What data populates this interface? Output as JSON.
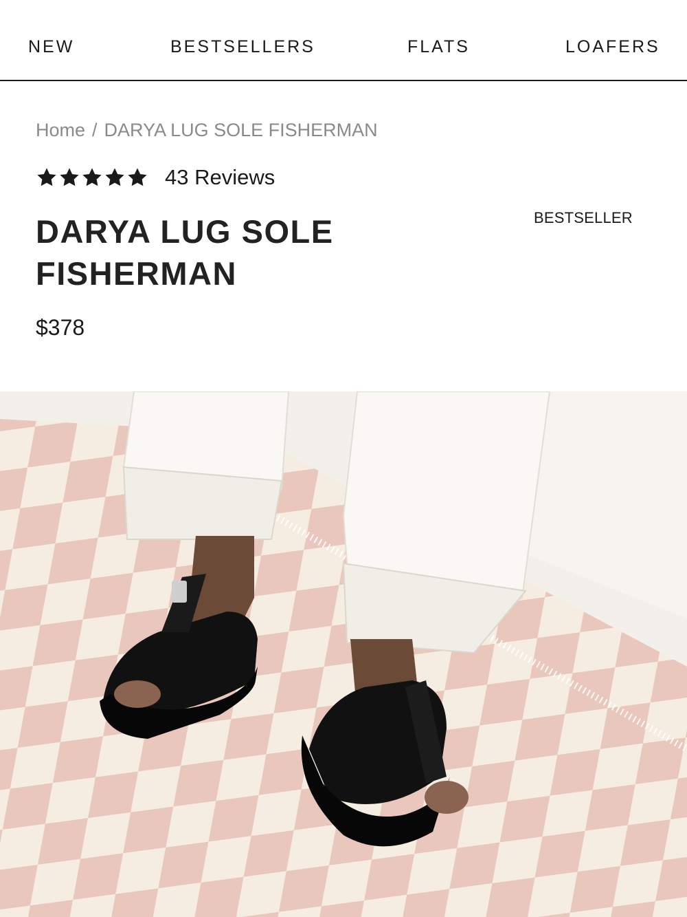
{
  "nav": {
    "items": [
      "NEW",
      "BESTSELLERS",
      "FLATS",
      "LOAFERS"
    ]
  },
  "breadcrumb": {
    "home": "Home",
    "separator": "/",
    "current": "DARYA LUG SOLE FISHERMAN"
  },
  "rating": {
    "stars": 5,
    "reviews_label": "43 Reviews"
  },
  "product": {
    "title": "DARYA LUG SOLE FISHERMAN",
    "badge": "BESTSELLER",
    "price": "$378"
  },
  "image": {
    "alt_description": "black-sandal-photo"
  },
  "colors": {
    "text": "#1a1a1a",
    "muted": "#8a8a8a",
    "rug_pink": "#e9c7bd",
    "rug_cream": "#f6ede2"
  }
}
